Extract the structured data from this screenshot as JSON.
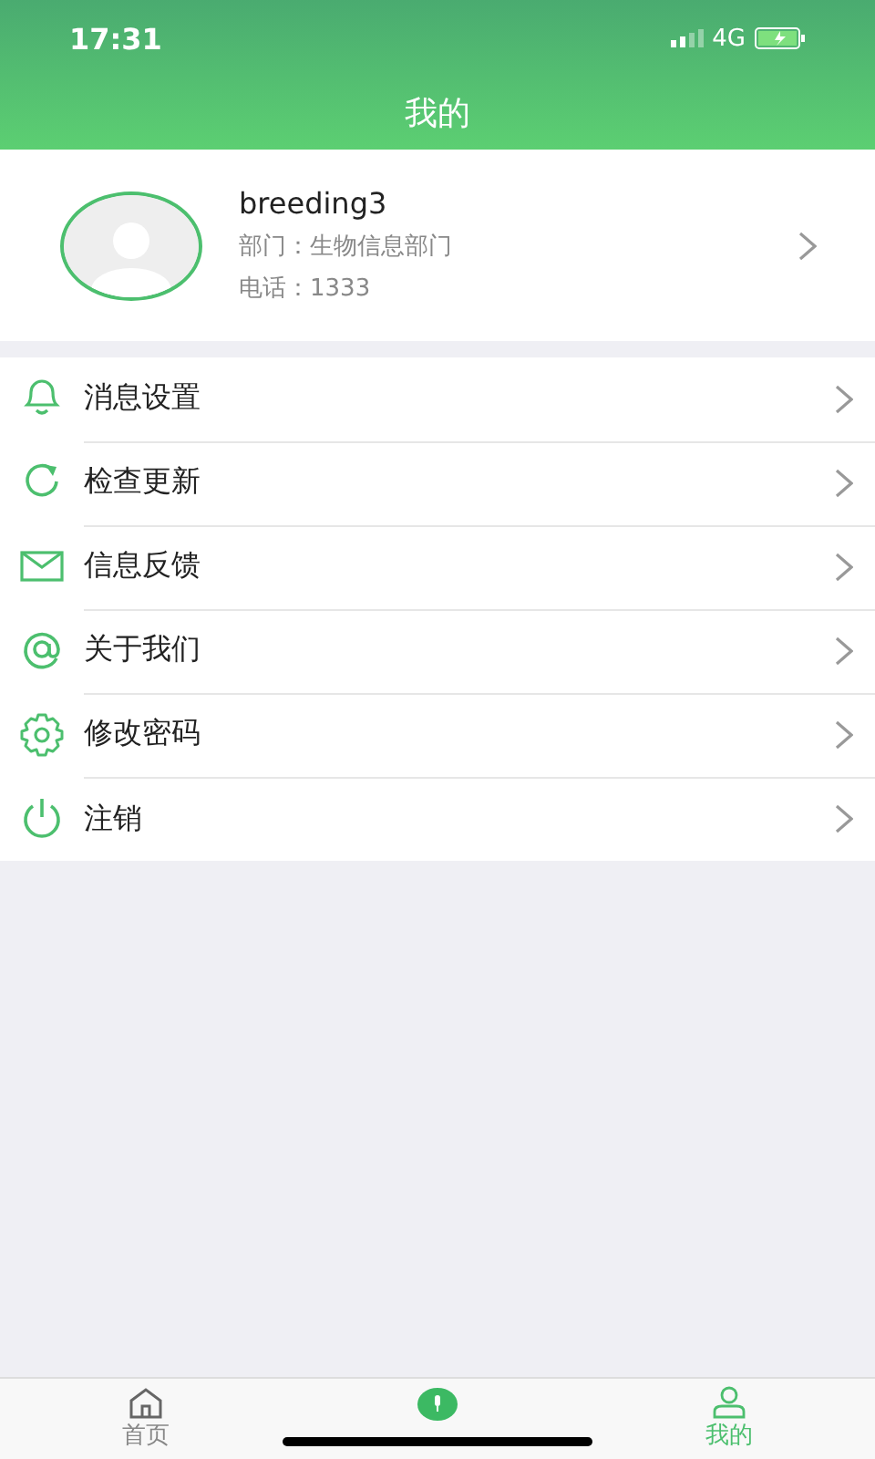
{
  "status_bar": {
    "time": "17:31",
    "network": "4G"
  },
  "header": {
    "title": "我的"
  },
  "profile": {
    "name": "breeding3",
    "department": "部门：生物信息部门",
    "phone": "电话：1333"
  },
  "menu": [
    {
      "label": "消息设置"
    },
    {
      "label": "检查更新"
    },
    {
      "label": "信息反馈"
    },
    {
      "label": "关于我们"
    },
    {
      "label": "修改密码"
    },
    {
      "label": "注销"
    }
  ],
  "tab_bar": [
    {
      "label": "首页",
      "selected": false
    },
    {
      "selected": false
    },
    {
      "label": "我的",
      "selected": true
    }
  ]
}
